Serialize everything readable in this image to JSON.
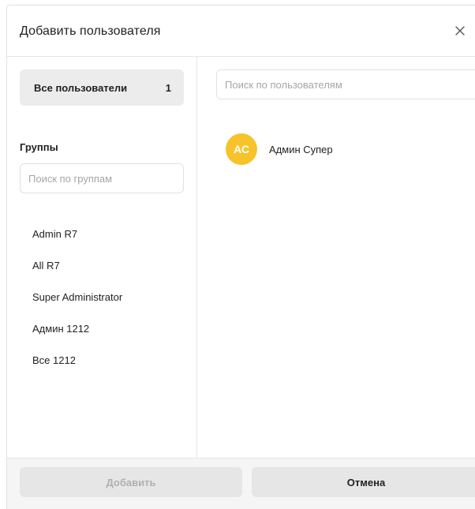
{
  "dialog": {
    "title": "Добавить пользователя",
    "close_icon": "close-icon"
  },
  "left": {
    "all_users": {
      "label": "Все пользователи",
      "count": "1"
    },
    "groups_title": "Группы",
    "group_search_placeholder": "Поиск по группам",
    "groups": [
      "Admin R7",
      "All R7",
      "Super Administrator",
      "Админ 1212",
      "Все 1212"
    ]
  },
  "right": {
    "user_search_placeholder": "Поиск по пользователям",
    "users": [
      {
        "initials": "АС",
        "name": "Админ Супер",
        "avatar_color": "#f7c32a"
      }
    ]
  },
  "footer": {
    "add_label": "Добавить",
    "cancel_label": "Отмена"
  }
}
